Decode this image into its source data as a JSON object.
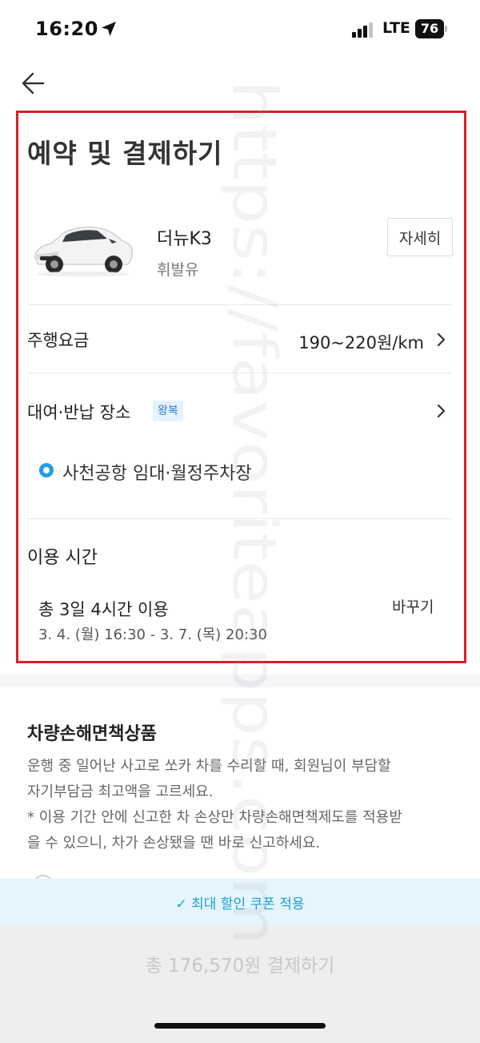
{
  "status_bar": {
    "time": "16:20",
    "network": "LTE",
    "battery": "76",
    "icons": [
      "location-arrow-icon",
      "signal-icon"
    ]
  },
  "header": {
    "back_icon": "arrow-left-icon",
    "title": "예약 및 결제하기"
  },
  "car": {
    "name": "더뉴K3",
    "fuel": "휘발유",
    "details_label": "자세히"
  },
  "fee": {
    "label": "주행요금",
    "value": "190~220원/km"
  },
  "place": {
    "label": "대여·반납 장소",
    "badge": "왕복",
    "name": "사천공항 임대·월정주차장"
  },
  "usage_time": {
    "label": "이용 시간",
    "summary": "총 3일 4시간 이용",
    "range": "3. 4. (월) 16:30 - 3. 7. (목) 20:30",
    "change_label": "바꾸기"
  },
  "insurance": {
    "title": "차량손해면책상품",
    "lines": [
      "운행 중 일어난 사고로 쏘카 차를 수리할 때, 회원님이 부담할",
      "자기부담금 최고액을 고르세요.",
      "* 이용 기간 안에 신고한 차 손상만 차량손해면책제도를 적용받",
      "을 수 있으니, 차가 손상됐을 땐 바로 신고하세요."
    ]
  },
  "coupon": {
    "label": "✓ 최대 할인 쿠폰 적용"
  },
  "payment": {
    "label": "총 176,570원 결제하기"
  },
  "watermark": "https://favoriteapps.com",
  "colors": {
    "highlight": "#d6202a",
    "accent": "#1e9eea",
    "coupon_text": "#19a2d8",
    "badge_bg": "#e6f2fb"
  }
}
